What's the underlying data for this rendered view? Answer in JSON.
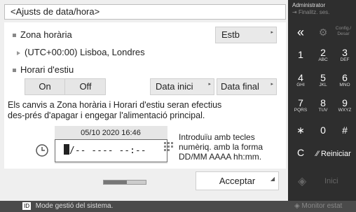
{
  "title": "<Ajusts de data/hora>",
  "timezone": {
    "label": "Zona horària",
    "button": "Estb",
    "value": "(UTC+00:00) Lisboa, Londres"
  },
  "dst": {
    "label": "Horari d'estiu",
    "on": "On",
    "off": "Off",
    "start": "Data inici",
    "end": "Data final"
  },
  "note": "Els canvis a Zona horària i Horari d'estiu seran efectius des-prés d'apagar i engegar l'alimentació principal.",
  "date": {
    "current": "05/10 2020 16:46",
    "input": "/-- ---- --:--",
    "hint": [
      "Introduïu amb tecles",
      "numèriq. amb la forma",
      "DD/MM AAAA hh:mm."
    ]
  },
  "accept": "Acceptar",
  "progress": 0.55,
  "status": "Mode gestió del sistema.",
  "status_badge": "ID",
  "admin": {
    "user": "Administrator",
    "logout": "Finalitz. ses."
  },
  "keypad": {
    "back": "«",
    "config": "Config./ Desar",
    "keys": [
      {
        "n": "1",
        "s": ""
      },
      {
        "n": "2",
        "s": "ABC"
      },
      {
        "n": "3",
        "s": "DEF"
      },
      {
        "n": "4",
        "s": "GHI"
      },
      {
        "n": "5",
        "s": "JKL"
      },
      {
        "n": "6",
        "s": "MNO"
      },
      {
        "n": "7",
        "s": "PQRS"
      },
      {
        "n": "8",
        "s": "TUV"
      },
      {
        "n": "9",
        "s": "WXYZ"
      },
      {
        "n": "∗",
        "s": ""
      },
      {
        "n": "0",
        "s": ""
      },
      {
        "n": "#",
        "s": ""
      }
    ],
    "clear": "C",
    "reset": "Reiniciar",
    "start": "Inici",
    "monitor": "Monitor estat"
  },
  "colors": {
    "accent": "#2e2e2e",
    "panel": "#ffffff",
    "button": "#e9e9e9"
  }
}
